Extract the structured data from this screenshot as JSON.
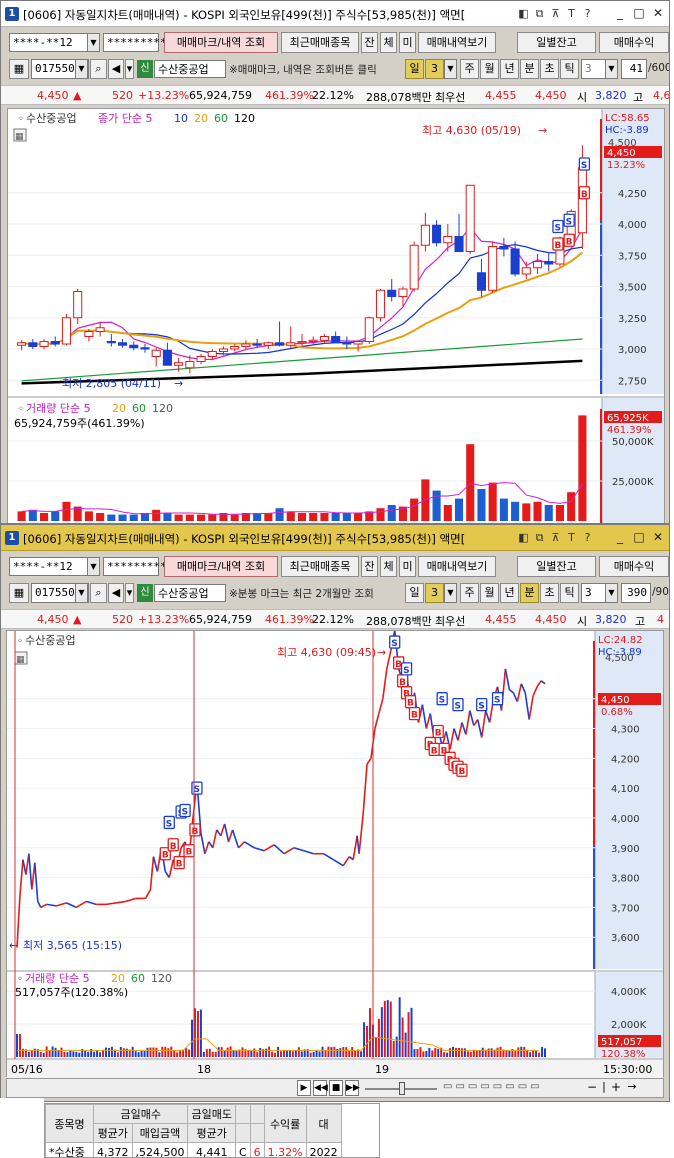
{
  "window1": {
    "num": "1",
    "title": "[0606] 자동일지차트(매매내역) - KOSPI 외국인보유[499(천)] 주식수[53,985(천)] 액면[",
    "account_field": "****-**12",
    "password_field": "*********",
    "buttons": [
      "매매마크/내역 조회",
      "최근매매종목",
      "잔",
      "체",
      "미",
      "매매내역보기",
      "일별잔고",
      "매매수익"
    ],
    "code": "017550",
    "stock_badge": "신",
    "stock_name": "수산중공업",
    "note": "※매매마크, 내역은 조회버튼 클릭",
    "period_buttons": [
      "일",
      "3",
      "주",
      "월",
      "년",
      "분",
      "초",
      "틱"
    ],
    "tick_value": "3",
    "count_value": "41",
    "count_total": "/600",
    "quote": {
      "price": "4,450",
      "arrow": "▲",
      "change": "520",
      "rate": "+13.23%",
      "volume": "65,924,759",
      "vol_rate": "461.39%",
      "turnover": "22.12%",
      "amount": "288,078백만",
      "pref_label": "최우선",
      "pref_value": "4,455",
      "ask": "4,450",
      "open_label": "시",
      "open_value": "3,820",
      "high_label": "고",
      "high_value": "4,6"
    },
    "chart": {
      "stock_label": "수산중공업",
      "ma_labels": [
        "종가 단순 5",
        "10",
        "20",
        "60",
        "120"
      ],
      "high_note": "최고 4,630 (05/19)",
      "low_note": "최저 2,805 (04/11)",
      "lc": "LC:58.65",
      "hc": "HC:-3.89",
      "price_tag": "4,450",
      "rate_tag": "13.23%",
      "top_tick_label": "4,500",
      "vol_label": "거래량 단순 5",
      "vol_ma": [
        "20",
        "60",
        "120"
      ],
      "vol_value": "65,924,759주(461.39%)",
      "vol_tag": "65,925K",
      "vol_rate_tag": "461.39%"
    }
  },
  "window2": {
    "num": "1",
    "title": "[0606] 자동일지차트(매매내역) - KOSPI 외국인보유[499(천)] 주식수[53,985(천)] 액면[",
    "account_field": "****-**12",
    "password_field": "*********",
    "buttons": [
      "매매마크/내역 조회",
      "최근매매종목",
      "잔",
      "체",
      "미",
      "매매내역보기",
      "일별잔고",
      "매매수익"
    ],
    "code": "017550",
    "stock_badge": "신",
    "stock_name": "수산중공업",
    "note": "※분봉 마크는 최근 2개월만 조회",
    "period_buttons": [
      "일",
      "3",
      "주",
      "월",
      "년",
      "분",
      "초",
      "틱"
    ],
    "tick_value": "3",
    "count_value": "390",
    "count_total": "/90",
    "quote": {
      "price": "4,450",
      "arrow": "▲",
      "change": "520",
      "rate": "+13.23%",
      "volume": "65,924,759",
      "vol_rate": "461.39%",
      "turnover": "22.12%",
      "amount": "288,078백만",
      "pref_label": "최우선",
      "pref_value": "4,455",
      "ask": "4,450",
      "open_label": "시",
      "open_value": "3,820",
      "high_label": "고",
      "high_value": "4"
    },
    "chart": {
      "stock_label": "수산중공업",
      "high_note": "최고 4,630 (09:45)",
      "low_note": "최저 3,565 (15:15)",
      "lc": "LC:24.82",
      "hc": "HC:-3.89",
      "price_tag": "4,450",
      "rate_tag": "0.68%",
      "top_tick_label": "4,500",
      "vol_label": "거래량 단순 5",
      "vol_ma": [
        "20",
        "60",
        "120"
      ],
      "vol_value": "517,057주(120.38%)",
      "vol_tag": "517,057",
      "vol_rate_tag": "120.38%",
      "date_labels": [
        "05/16",
        "18",
        "19"
      ],
      "time_label": "15:30:00"
    }
  },
  "table": {
    "headers_top": [
      "종목명",
      "금일매수",
      "금일매도",
      "수익률",
      "대"
    ],
    "headers_sub": [
      "평균가",
      "매입금액",
      "평균가"
    ],
    "row": [
      "*수산중",
      "4,372",
      ",524,500",
      "4,441",
      "C",
      "6",
      "1.32%",
      "2022"
    ]
  },
  "chart_data": [
    {
      "type": "candlestick",
      "title": "",
      "x_unit": "trading days",
      "yaxis_ticks": [
        4500,
        4250,
        4000,
        3750,
        3500,
        3250,
        3000,
        2750
      ],
      "ylim": [
        2680,
        4680
      ],
      "candles": [
        [
          3030,
          3070,
          2990,
          3050
        ],
        [
          3050,
          3080,
          3000,
          3020
        ],
        [
          3020,
          3080,
          3000,
          3060
        ],
        [
          3060,
          3100,
          3020,
          3040
        ],
        [
          3040,
          3280,
          3030,
          3250
        ],
        [
          3250,
          3480,
          3200,
          3460
        ],
        [
          3100,
          3160,
          3060,
          3140
        ],
        [
          3140,
          3220,
          3100,
          3170
        ],
        [
          3060,
          3120,
          3020,
          3050
        ],
        [
          3050,
          3080,
          3010,
          3030
        ],
        [
          3030,
          3060,
          2990,
          3010
        ],
        [
          3010,
          3040,
          2970,
          3000
        ],
        [
          2940,
          3010,
          2860,
          2990
        ],
        [
          2990,
          3050,
          2920,
          2870
        ],
        [
          2870,
          2930,
          2820,
          2890
        ],
        [
          2850,
          2950,
          2805,
          2900
        ],
        [
          2900,
          2960,
          2880,
          2940
        ],
        [
          2940,
          3000,
          2920,
          2980
        ],
        [
          2980,
          3020,
          2950,
          3000
        ],
        [
          3000,
          3040,
          2980,
          3020
        ],
        [
          3020,
          3070,
          3000,
          3040
        ],
        [
          3040,
          3080,
          3010,
          3030
        ],
        [
          3030,
          3060,
          3000,
          3050
        ],
        [
          3050,
          3220,
          3020,
          3030
        ],
        [
          3030,
          3180,
          3010,
          3050
        ],
        [
          3050,
          3120,
          3020,
          3060
        ],
        [
          3060,
          3100,
          3030,
          3070
        ],
        [
          3070,
          3120,
          3050,
          3100
        ],
        [
          3100,
          3140,
          3060,
          3050
        ],
        [
          3050,
          3100,
          3000,
          3040
        ],
        [
          3040,
          3070,
          2980,
          3060
        ],
        [
          3060,
          3260,
          3040,
          3250
        ],
        [
          3250,
          3480,
          3220,
          3470
        ],
        [
          3470,
          3560,
          3380,
          3420
        ],
        [
          3420,
          3500,
          3340,
          3480
        ],
        [
          3480,
          3860,
          3460,
          3830
        ],
        [
          3830,
          4090,
          3780,
          3990
        ],
        [
          3990,
          4030,
          3820,
          3850
        ],
        [
          3850,
          4000,
          3780,
          3900
        ],
        [
          3900,
          4080,
          3830,
          3780
        ],
        [
          3780,
          4300,
          3760,
          4310
        ],
        [
          3610,
          3720,
          3420,
          3470
        ],
        [
          3470,
          3860,
          3450,
          3820
        ],
        [
          3820,
          3890,
          3740,
          3800
        ],
        [
          3800,
          3860,
          3580,
          3600
        ],
        [
          3600,
          3700,
          3560,
          3650
        ],
        [
          3650,
          3760,
          3600,
          3700
        ],
        [
          3700,
          3770,
          3620,
          3680
        ],
        [
          3680,
          3900,
          3660,
          3880
        ],
        [
          3880,
          4120,
          3850,
          4100
        ],
        [
          3930,
          4630,
          3800,
          4450
        ]
      ]
    },
    {
      "type": "line",
      "title": "",
      "x_unit": "3-minute bars",
      "yaxis_ticks": [
        4500,
        4400,
        4300,
        4200,
        4100,
        4000,
        3900,
        3800,
        3700,
        3600
      ],
      "ylim": [
        3500,
        4560
      ],
      "price_path": [
        [
          0,
          3565
        ],
        [
          3,
          3740
        ],
        [
          6,
          3860
        ],
        [
          9,
          3810
        ],
        [
          12,
          3880
        ],
        [
          15,
          3760
        ],
        [
          18,
          3850
        ],
        [
          21,
          3720
        ],
        [
          24,
          3700
        ],
        [
          30,
          3710
        ],
        [
          40,
          3705
        ],
        [
          50,
          3715
        ],
        [
          60,
          3700
        ],
        [
          70,
          3720
        ],
        [
          80,
          3710
        ],
        [
          90,
          3710
        ],
        [
          100,
          3715
        ],
        [
          110,
          3720
        ],
        [
          120,
          3730
        ],
        [
          130,
          3730
        ],
        [
          135,
          3760
        ],
        [
          138,
          3870
        ],
        [
          142,
          3820
        ],
        [
          146,
          3900
        ],
        [
          150,
          3820
        ],
        [
          154,
          3800
        ],
        [
          158,
          3860
        ],
        [
          162,
          3840
        ],
        [
          166,
          3900
        ],
        [
          170,
          3920
        ],
        [
          174,
          3870
        ],
        [
          178,
          4000
        ],
        [
          182,
          4120
        ],
        [
          186,
          3950
        ],
        [
          190,
          3880
        ],
        [
          194,
          3920
        ],
        [
          198,
          3900
        ],
        [
          202,
          3960
        ],
        [
          206,
          3940
        ],
        [
          210,
          3980
        ],
        [
          214,
          3920
        ],
        [
          218,
          3960
        ],
        [
          224,
          3900
        ],
        [
          230,
          3920
        ],
        [
          240,
          3900
        ],
        [
          250,
          3890
        ],
        [
          260,
          3910
        ],
        [
          270,
          3880
        ],
        [
          280,
          3900
        ],
        [
          290,
          3890
        ],
        [
          300,
          3880
        ],
        [
          310,
          3880
        ],
        [
          320,
          3860
        ],
        [
          330,
          3840
        ],
        [
          336,
          3870
        ],
        [
          340,
          3860
        ],
        [
          344,
          3940
        ],
        [
          346,
          3880
        ],
        [
          350,
          4010
        ],
        [
          354,
          4180
        ],
        [
          358,
          4200
        ],
        [
          362,
          4300
        ],
        [
          366,
          4350
        ],
        [
          370,
          4400
        ],
        [
          374,
          4500
        ],
        [
          378,
          4560
        ],
        [
          382,
          4630
        ],
        [
          386,
          4500
        ],
        [
          390,
          4460
        ],
        [
          394,
          4500
        ],
        [
          398,
          4350
        ],
        [
          402,
          4420
        ],
        [
          406,
          4320
        ],
        [
          410,
          4380
        ],
        [
          414,
          4300
        ],
        [
          418,
          4350
        ],
        [
          422,
          4260
        ],
        [
          426,
          4300
        ],
        [
          430,
          4240
        ],
        [
          434,
          4290
        ],
        [
          438,
          4230
        ],
        [
          442,
          4300
        ],
        [
          446,
          4260
        ],
        [
          450,
          4320
        ],
        [
          454,
          4280
        ],
        [
          458,
          4360
        ],
        [
          462,
          4310
        ],
        [
          466,
          4330
        ],
        [
          470,
          4270
        ],
        [
          474,
          4360
        ],
        [
          478,
          4320
        ],
        [
          482,
          4400
        ],
        [
          486,
          4440
        ],
        [
          490,
          4360
        ],
        [
          494,
          4500
        ],
        [
          498,
          4430
        ],
        [
          502,
          4420
        ],
        [
          506,
          4390
        ],
        [
          510,
          4450
        ],
        [
          514,
          4420
        ],
        [
          518,
          4330
        ],
        [
          522,
          4410
        ],
        [
          526,
          4440
        ],
        [
          530,
          4460
        ],
        [
          534,
          4450
        ]
      ]
    }
  ]
}
